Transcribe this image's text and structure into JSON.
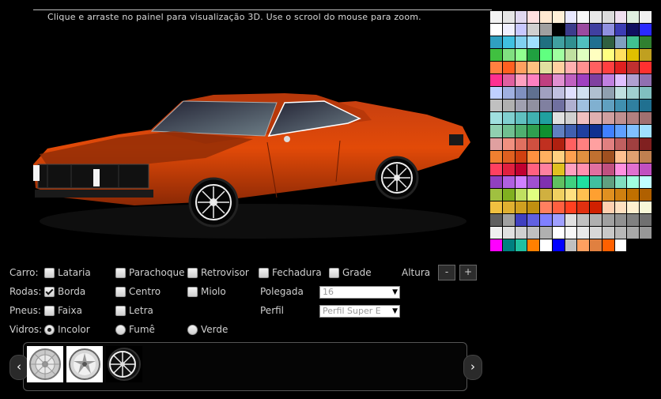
{
  "instruction": "Clique e arraste no painel para visualização 3D. Use o scrool do mouse para zoom.",
  "car": {
    "body_color": "#d94a0a",
    "wheel_style": "black-spoke"
  },
  "palette": {
    "colors": [
      [
        "#f2f2f2",
        "#e6e6e6",
        "#e0d8f0",
        "#ffe0e0",
        "#ffe8d0",
        "#fff0d8",
        "#e8e8ff",
        "#f8f8f8",
        "#e8e8e8",
        "#dcdcdc",
        "#f0e0f0",
        "#e0f0e0",
        "#f0f0f0"
      ],
      [
        "#ffffff",
        "#f0f0ff",
        "#c8c8ff",
        "#d0d0d0",
        "#a0a0a0",
        "#000000",
        "#3c3c8c",
        "#9a4aa0",
        "#4040a0",
        "#9090e0",
        "#3c3cb4",
        "#101060",
        "#2a2aff"
      ],
      [
        "#30a0c0",
        "#40c0e0",
        "#80d0f0",
        "#a0e0ff",
        "#207080",
        "#40a0a0",
        "#309090",
        "#50c0c0",
        "#207090",
        "#306040",
        "#80a0c0",
        "#40c090",
        "#308030"
      ],
      [
        "#40c040",
        "#80e080",
        "#90ff90",
        "#20a040",
        "#60ff80",
        "#a0ffa0",
        "#c0e0a0",
        "#e0ffc0",
        "#ffffc0",
        "#ffff80",
        "#ffe060",
        "#e0c000",
        "#c0a020"
      ],
      [
        "#ff8040",
        "#ff6020",
        "#ffa060",
        "#ffc080",
        "#e0e0a0",
        "#ffd0a0",
        "#ffb0b0",
        "#ff9090",
        "#ff6060",
        "#ff4040",
        "#e02020",
        "#c03030",
        "#ff3030"
      ],
      [
        "#ff3090",
        "#e060a0",
        "#ffa0c0",
        "#ff80c0",
        "#c04080",
        "#e090d0",
        "#c060c0",
        "#a040c0",
        "#8040a0",
        "#c080e0",
        "#e0c0ff",
        "#b0a0d0",
        "#9070b0"
      ],
      [
        "#c0d0ff",
        "#a0b0e0",
        "#8090c0",
        "#607090",
        "#a0a0c0",
        "#c0c0e0",
        "#e0e0ff",
        "#d0e0f0",
        "#b0c0d0",
        "#90a0b0",
        "#c0e0e0",
        "#a0d0d0",
        "#80c0c0"
      ],
      [
        "#c0c0c0",
        "#b0b0b0",
        "#a0a0b0",
        "#9090a0",
        "#8080a0",
        "#7070a0",
        "#b0b0d0",
        "#a0c0e0",
        "#80b0d0",
        "#60a0c0",
        "#4090b0",
        "#3080a0",
        "#207090"
      ],
      [
        "#a0e0e0",
        "#80d0d0",
        "#60c0c0",
        "#40b0b0",
        "#20a0a0",
        "#e0e0e0",
        "#d0d0d0",
        "#f0c0c0",
        "#e0b0b0",
        "#d0a0a0",
        "#c09090",
        "#b08080",
        "#a07070"
      ],
      [
        "#90d0b0",
        "#70c090",
        "#50b070",
        "#30a050",
        "#109030",
        "#6080c0",
        "#4060b0",
        "#2040a0",
        "#103090",
        "#4080ff",
        "#60a0ff",
        "#80c0ff",
        "#a0e0ff"
      ],
      [
        "#e0a0a0",
        "#f09080",
        "#e07060",
        "#d05040",
        "#c03020",
        "#b02010",
        "#ff6060",
        "#ff8080",
        "#ffa0a0",
        "#e08080",
        "#c06060",
        "#a04040",
        "#802020"
      ],
      [
        "#f08030",
        "#e06020",
        "#d04010",
        "#ff9040",
        "#ffb060",
        "#ffd080",
        "#ffa050",
        "#e09040",
        "#c07030",
        "#a05020",
        "#ffc090",
        "#e0a070",
        "#c08050"
      ],
      [
        "#ff4060",
        "#e02040",
        "#c00030",
        "#ff6080",
        "#ff80a0",
        "#e0c020",
        "#ffa0c0",
        "#ff90b0",
        "#e070a0",
        "#c05080",
        "#ff90e0",
        "#e070d0",
        "#c050c0"
      ],
      [
        "#9040c0",
        "#b060e0",
        "#d080ff",
        "#a050d0",
        "#8030b0",
        "#60c060",
        "#40d080",
        "#20e0a0",
        "#40c0a0",
        "#60a080",
        "#80e0c0",
        "#a0ffe0",
        "#c0ffff"
      ],
      [
        "#a0c040",
        "#80b020",
        "#c0e060",
        "#e0ff80",
        "#d0b040",
        "#f0d060",
        "#ffe080",
        "#ffc050",
        "#ffa030",
        "#e09020",
        "#d08010",
        "#c07000",
        "#b06000"
      ],
      [
        "#f0c040",
        "#e0b030",
        "#d0a020",
        "#c09010",
        "#ff8060",
        "#ff6040",
        "#ff4020",
        "#e03010",
        "#d02000",
        "#ffd0b0",
        "#ffe0c0",
        "#fff0d0",
        "#f8f8d8"
      ],
      [
        "#606060",
        "#a0a0a0",
        "#4040c0",
        "#6060e0",
        "#8080ff",
        "#a0a0ff",
        "#e0e0e0",
        "#c0c0c0",
        "#b0b0b0",
        "#a0a0a0",
        "#909090",
        "#808080",
        "#707070"
      ],
      [
        "#f0f0f0",
        "#e0e0e0",
        "#d0d0d0",
        "#c0c0c0",
        "#b0b0b0",
        "#ffffff",
        "#f8f8f8",
        "#e8e8e8",
        "#d8d8d8",
        "#c8c8c8",
        "#b8b8b8",
        "#a8a8a8",
        "#989898"
      ],
      [
        "#ff00ff",
        "#008080",
        "#20c0a0",
        "#ff8000",
        "#ffffff",
        "#0000ff",
        "#c0c0c0",
        "#ffa060",
        "#e08040",
        "#ff6000",
        "#ffffff",
        "#000000",
        "#000000"
      ]
    ]
  },
  "controls": {
    "carro": {
      "label": "Carro:",
      "options": [
        "Lataria",
        "Parachoque",
        "Retrovisor",
        "Fechadura",
        "Grade"
      ],
      "checked": [
        false,
        false,
        false,
        false,
        false
      ],
      "altura_label": "Altura",
      "minus_label": "-",
      "plus_label": "+"
    },
    "rodas": {
      "label": "Rodas:",
      "options": [
        "Borda",
        "Centro",
        "Miolo"
      ],
      "checked": [
        true,
        false,
        false
      ],
      "polegada_label": "Polegada",
      "polegada_value": "16"
    },
    "pneus": {
      "label": "Pneus:",
      "options": [
        "Faixa",
        "Letra"
      ],
      "checked": [
        false,
        false
      ],
      "perfil_label": "Perfil",
      "perfil_value": "Perfil Super E"
    },
    "vidros": {
      "label": "Vidros:",
      "options": [
        "Incolor",
        "Fumê",
        "Verde"
      ],
      "selected_index": 0
    }
  },
  "gallery": {
    "prev_label": "‹",
    "next_label": "›",
    "thumbs": [
      "chrome-wheel-thumbnail",
      "five-spoke-wheel-thumbnail",
      "black-wheel-thumbnail"
    ]
  }
}
